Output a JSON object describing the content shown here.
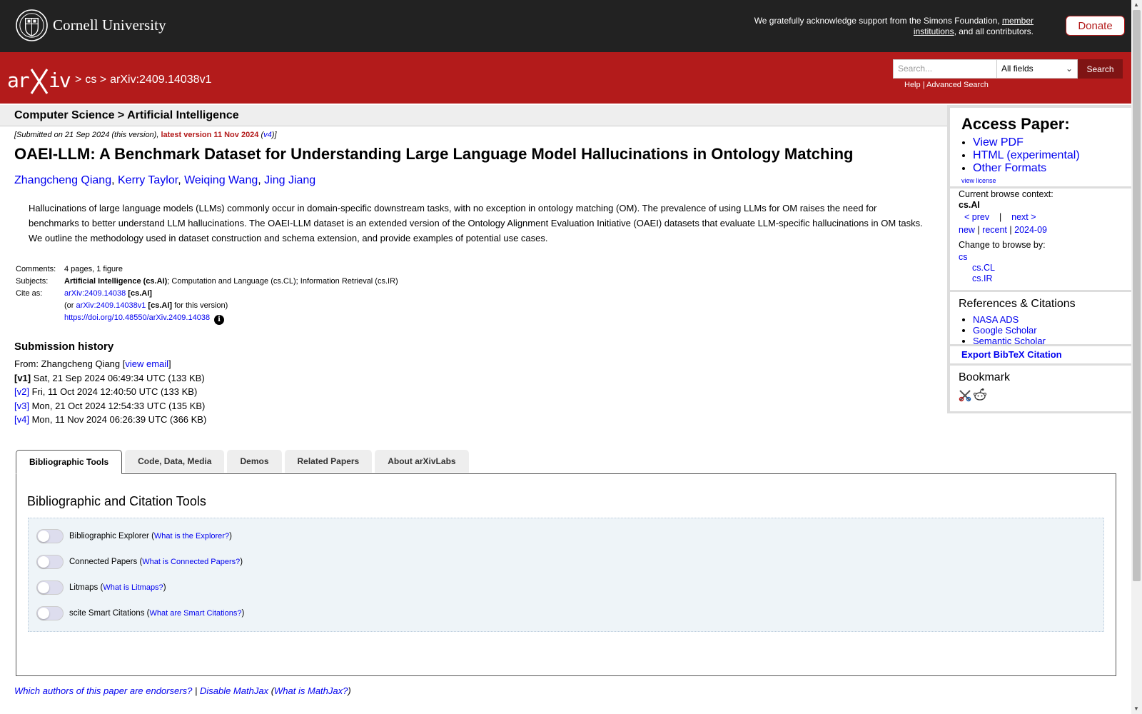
{
  "header": {
    "university": "Cornell University",
    "ack_prefix": "We gratefully acknowledge support from the Simons Foundation, ",
    "ack_link": "member institutions",
    "ack_suffix": ", and all contributors.",
    "donate_label": "Donate"
  },
  "nav": {
    "sep1": ">",
    "crumb_cs": "cs",
    "sep2": ">",
    "crumb_id": "arXiv:2409.14038v1",
    "search_placeholder": "Search...",
    "search_field": "All fields",
    "search_button": "Search",
    "help": "Help",
    "help_sep": "|",
    "advanced": "Advanced Search"
  },
  "paper": {
    "category_heading": "Computer Science > Artificial Intelligence",
    "submitted": "[Submitted on 21 Sep 2024 (this version), ",
    "latest": "latest version 11 Nov 2024",
    "latest_open": " (",
    "latest_v": "v4",
    "latest_close": ")]",
    "title": "OAEI-LLM: A Benchmark Dataset for Understanding Large Language Model Hallucinations in Ontology Matching",
    "authors": [
      "Zhangcheng Qiang",
      "Kerry Taylor",
      "Weiqing Wang",
      "Jing Jiang"
    ],
    "abstract": "Hallucinations of large language models (LLMs) commonly occur in domain-specific downstream tasks, with no exception in ontology matching (OM). The prevalence of using LLMs for OM raises the need for benchmarks to better understand LLM hallucinations. The OAEI-LLM dataset is an extended version of the Ontology Alignment Evaluation Initiative (OAEI) datasets that evaluate LLM-specific hallucinations in OM tasks. We outline the methodology used in dataset construction and schema extension, and provide examples of potential use cases.",
    "comments_label": "Comments:",
    "comments": "4 pages, 1 figure",
    "subjects_label": "Subjects:",
    "subjects_primary": "Artificial Intelligence (cs.AI)",
    "subjects_rest": "; Computation and Language (cs.CL); Information Retrieval (cs.IR)",
    "cite_label": "Cite as:",
    "cite_id": "arXiv:2409.14038",
    "cite_cat": "[cs.AI]",
    "cite_or": "(or ",
    "cite_version_id": "arXiv:2409.14038v1",
    "cite_version_cat": "[cs.AI]",
    "cite_version_suffix": " for this version)",
    "doi": "https://doi.org/10.48550/arXiv.2409.14038",
    "info_glyph": "i"
  },
  "history": {
    "title": "Submission history",
    "from_prefix": "From: Zhangcheng Qiang [",
    "view_email": "view email",
    "from_suffix": "]",
    "versions": [
      {
        "tag": "[v1]",
        "text": " Sat, 21 Sep 2024 06:49:34 UTC (133 KB)"
      },
      {
        "tag": "[v2]",
        "text": " Fri, 11 Oct 2024 12:40:50 UTC (133 KB)"
      },
      {
        "tag": "[v3]",
        "text": " Mon, 21 Oct 2024 12:54:33 UTC (135 KB)"
      },
      {
        "tag": "[v4]",
        "text": " Mon, 11 Nov 2024 06:26:39 UTC (366 KB)"
      }
    ]
  },
  "tabs": [
    "Bibliographic Tools",
    "Code, Data, Media",
    "Demos",
    "Related Papers",
    "About arXivLabs"
  ],
  "tools": {
    "title": "Bibliographic and Citation Tools",
    "items": [
      {
        "label": "Bibliographic Explorer",
        "link": "What is the Explorer?"
      },
      {
        "label": "Connected Papers",
        "link": "What is Connected Papers?"
      },
      {
        "label": "Litmaps",
        "link": "What is Litmaps?"
      },
      {
        "label": "scite Smart Citations",
        "link": "What are Smart Citations?"
      }
    ]
  },
  "footer": {
    "endorsers": "Which authors of this paper are endorsers?",
    "sep": "|",
    "mathjax": "Disable MathJax",
    "what_open": "(",
    "what_mathjax": "What is MathJax?",
    "what_close": ")"
  },
  "sidebar": {
    "access_title": "Access Paper:",
    "access_links": [
      "View PDF",
      "HTML (experimental)",
      "Other Formats"
    ],
    "license": "view license",
    "context_label": "Current browse context:",
    "context_value": "cs.AI",
    "prev": "< prev",
    "pipe": "|",
    "next": "next >",
    "new": "new",
    "recent": "recent",
    "month": "2024-09",
    "change_label": "Change to browse by:",
    "change_cs": "cs",
    "change_cl": "cs.CL",
    "change_ir": "cs.IR",
    "refs_title": "References & Citations",
    "refs_links": [
      "NASA ADS",
      "Google Scholar",
      "Semantic Scholar"
    ],
    "bibtex": "Export BibTeX Citation",
    "bookmark_title": "Bookmark"
  },
  "colors": {
    "banner": "#222222",
    "brand_red": "#b31b1b",
    "link": "#0000ee",
    "tool_bg": "#eef4f8"
  }
}
